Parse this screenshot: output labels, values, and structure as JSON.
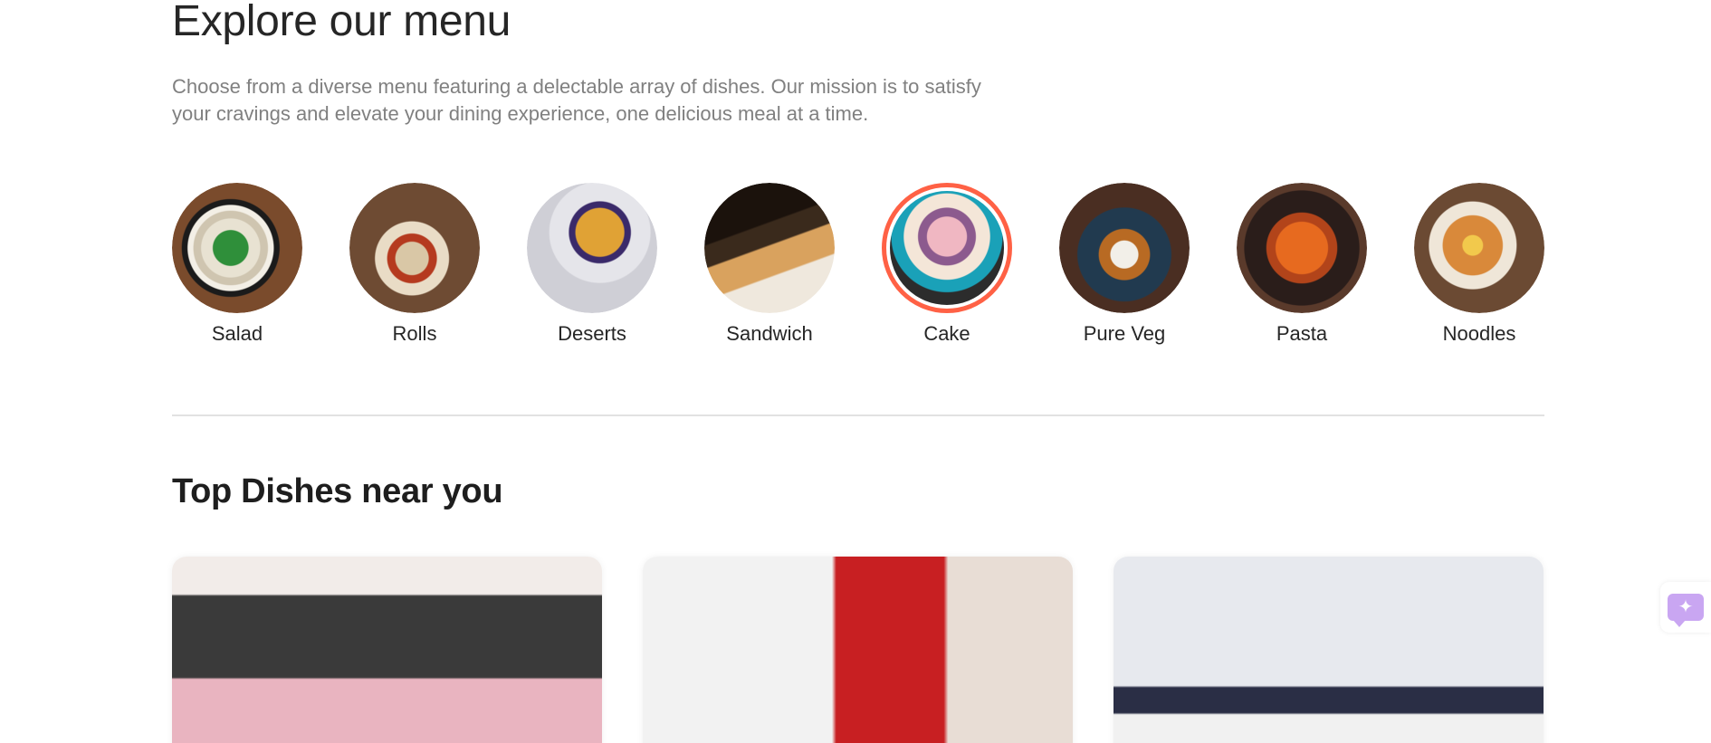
{
  "menu": {
    "title": "Explore our menu",
    "description": "Choose from a diverse menu featuring a delectable array of dishes. Our mission is to satisfy your cravings and elevate your dining experience, one delicious meal at a time.",
    "categories": [
      {
        "label": "Salad"
      },
      {
        "label": "Rolls"
      },
      {
        "label": "Deserts"
      },
      {
        "label": "Sandwich"
      },
      {
        "label": "Cake",
        "active": true
      },
      {
        "label": "Pure Veg"
      },
      {
        "label": "Pasta"
      },
      {
        "label": "Noodles"
      }
    ]
  },
  "dishes": {
    "title": "Top Dishes near you"
  },
  "colors": {
    "accent": "#ff6145",
    "assistant": "#c9a6f2"
  },
  "assistant": {
    "icon": "sparkle-chat-icon"
  }
}
